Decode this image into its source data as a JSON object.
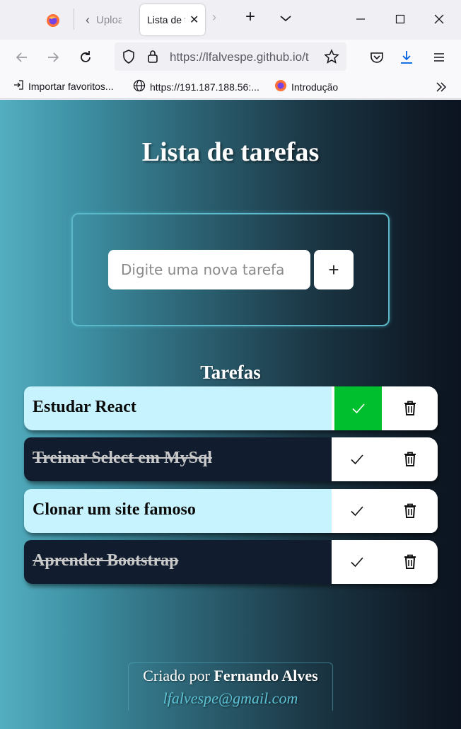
{
  "browser": {
    "tabs": [
      {
        "label": "Upload"
      },
      {
        "label": "Lista de tarefas"
      }
    ],
    "url": "https://lfalvespe.github.io/t",
    "bookmarks": [
      {
        "label": "Importar favoritos..."
      },
      {
        "label": "https://191.187.188.56:..."
      },
      {
        "label": "Introdução"
      }
    ]
  },
  "page": {
    "title": "Lista de tarefas",
    "input_placeholder": "Digite uma nova tarefa",
    "add_label": "+",
    "tasks_heading": "Tarefas",
    "tasks": [
      {
        "text": "Estudar React",
        "done": false
      },
      {
        "text": "Treinar Select em MySql",
        "done": true
      },
      {
        "text": "Clonar um site famoso",
        "done": false
      },
      {
        "text": "Aprender Bootstrap",
        "done": true
      }
    ],
    "footer": {
      "prefix": "Criado por",
      "author": "Fernando Alves",
      "email": "lfalvespe@gmail.com"
    }
  },
  "colors": {
    "checked_green": "#00bf2f",
    "pending_bg": "#c6f3fd",
    "done_bg": "#111d2e",
    "email": "#5fc4d6"
  }
}
